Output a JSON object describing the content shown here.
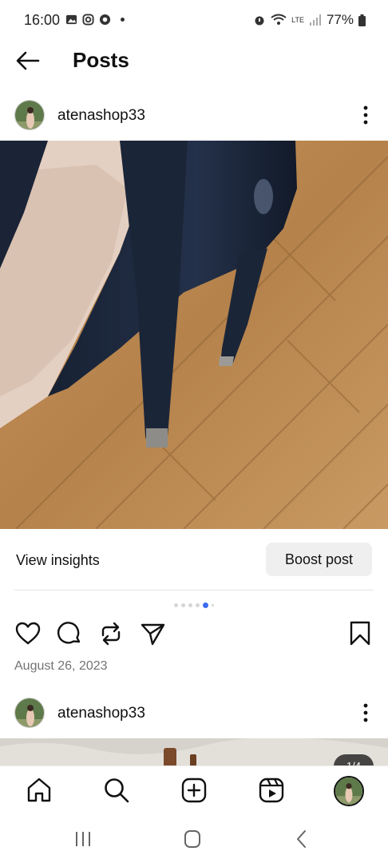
{
  "status_bar": {
    "time": "16:00",
    "battery": "77%",
    "network": "LTE"
  },
  "header": {
    "title": "Posts"
  },
  "post1": {
    "username": "atenashop33",
    "insights_label": "View insights",
    "boost_label": "Boost post",
    "date": "August 26, 2023",
    "carousel": {
      "total": 6,
      "active": 5
    }
  },
  "post2": {
    "username": "atenashop33",
    "counter": "1/4"
  },
  "colors": {
    "accent": "#3b6cf0",
    "date_gray": "#737373",
    "floor": "#b98a52",
    "shoe": "#1c2738"
  },
  "icons": {
    "back": "arrow-left-icon",
    "more": "more-vertical-icon",
    "like": "heart-icon",
    "comment": "comment-icon",
    "repost": "repost-icon",
    "share": "send-icon",
    "save": "bookmark-icon",
    "home": "home-icon",
    "search": "search-icon",
    "create": "plus-square-icon",
    "reels": "reels-icon"
  }
}
